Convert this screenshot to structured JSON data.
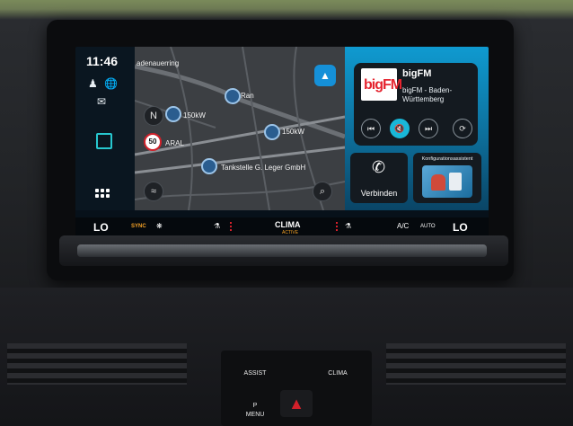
{
  "status": {
    "time": "11:46"
  },
  "map": {
    "street_label": "adenauerring",
    "poi_labels": [
      "Ran",
      "ARAL",
      "Tankstelle G. Leger GmbH"
    ],
    "charger_labels": [
      "150kW",
      "150kW"
    ],
    "speed_limit": "50",
    "icons": [
      "profile-icon",
      "globe-icon",
      "message-icon",
      "apps-icon",
      "navigation-icon",
      "search-icon",
      "traffic-icon"
    ]
  },
  "radio": {
    "station": "bigFM",
    "logo_text": "bigFM",
    "subtitle": "bigFM - Baden-Württemberg",
    "controls": [
      "previous",
      "mute",
      "next",
      "sources"
    ]
  },
  "phone": {
    "label": "Verbinden"
  },
  "config": {
    "title": "Konfigurationsassistent"
  },
  "climate": {
    "left_temp": "LO",
    "right_temp": "LO",
    "sync": "SYNC",
    "clima": "CLIMA",
    "clima_sub": "ACTIVE",
    "ac": "A/C",
    "auto": "AUTO"
  },
  "hardware": {
    "assist": "ASSIST",
    "clima": "CLIMA",
    "menu": "MENU",
    "park_symbol": "P"
  },
  "colors": {
    "accent": "#19b7d8",
    "sync_orange": "#f3a126",
    "heat_red": "#d3202a"
  }
}
